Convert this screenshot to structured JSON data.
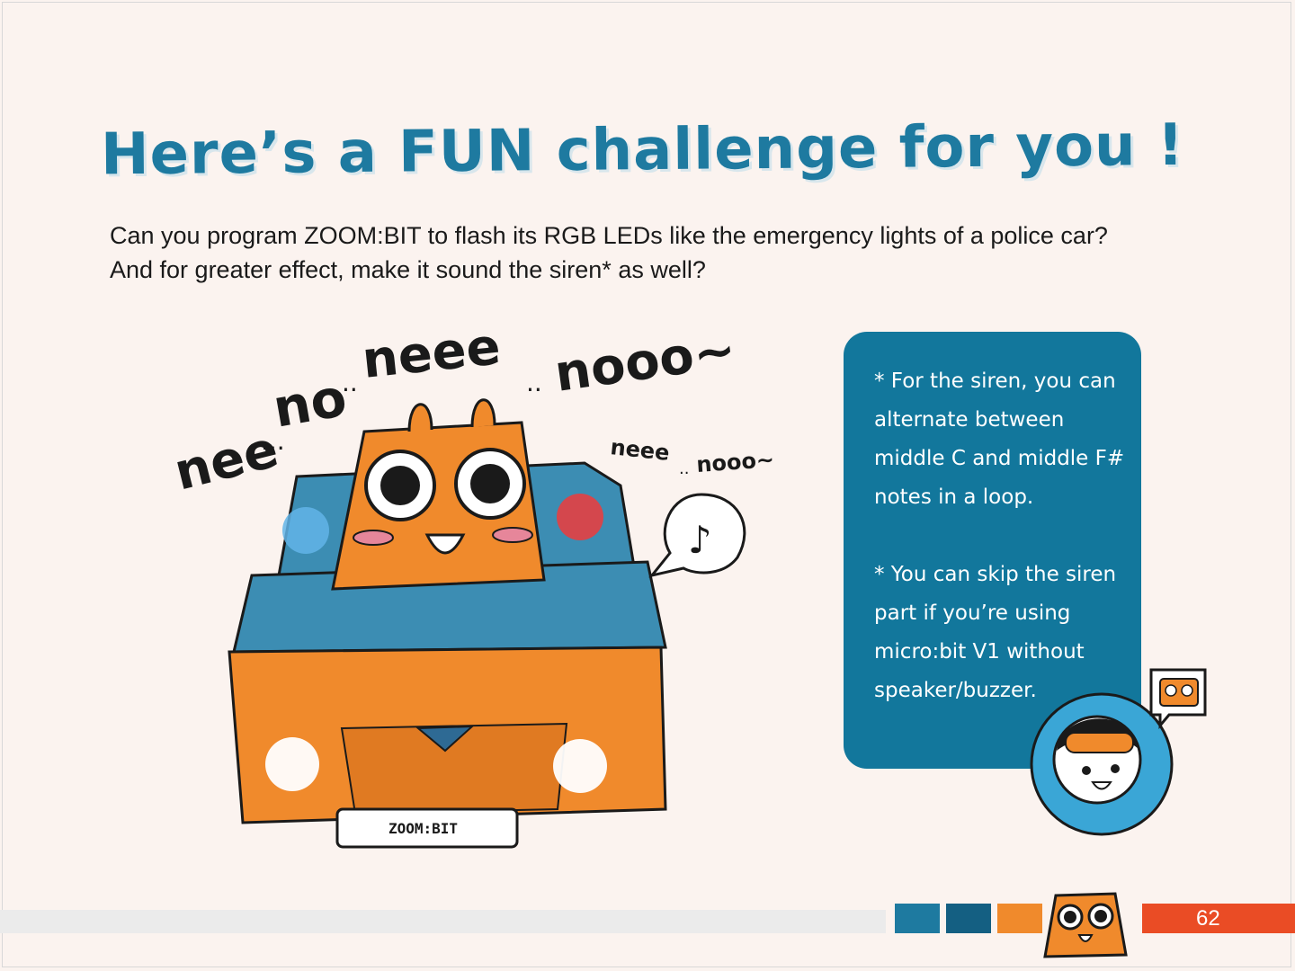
{
  "page": {
    "title": "Here’s a FUN challenge for you !",
    "intro_line1": "Can you program ZOOM:BIT to flash its RGB LEDs like the emergency lights of a police car?",
    "intro_line2": "And for greater effect, make it sound the siren* as well?",
    "page_number": "62"
  },
  "illustration": {
    "sound_big_1": "nee",
    "sound_big_2": "...",
    "sound_big_3": "no",
    "sound_big_4": "..",
    "sound_big_5": "neee",
    "sound_big_6": "..",
    "sound_big_7": "nooo~",
    "sound_small_1": "neee",
    "sound_small_2": "..",
    "sound_small_3": "nooo~",
    "plate": "ZOOM:BIT",
    "note_icon": "music-note-icon"
  },
  "tips": {
    "tip1": "* For the siren, you can alternate between middle C and middle F# notes in a loop.",
    "tip2": "* You can skip the siren part if you’re using micro:bit V1 without speaker/buzzer."
  },
  "colors": {
    "title": "#1e7aa0",
    "tip_box": "#12779c",
    "accent_orange": "#f08a2c",
    "page_bar": "#ea4c25",
    "car_blue": "#3c8db3",
    "background": "#fbf3ef"
  }
}
